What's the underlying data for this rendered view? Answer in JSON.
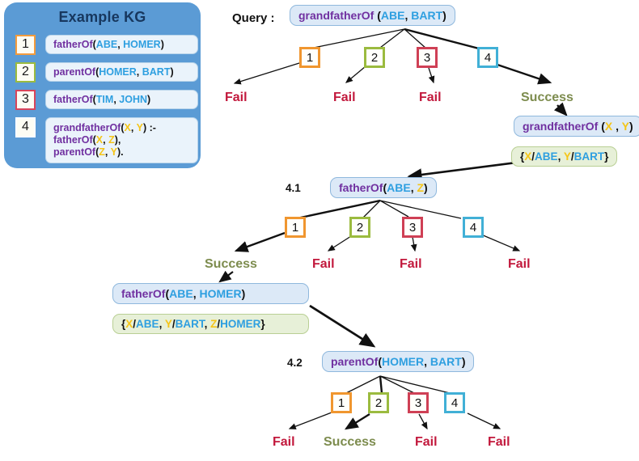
{
  "kg_panel": {
    "title": "Example KG",
    "rows": [
      {
        "badge": "1",
        "badge_color": "#f39c3d",
        "tokens": [
          {
            "t": "fatherOf",
            "c": "pred"
          },
          {
            "t": "(",
            "c": "punc"
          },
          {
            "t": "ABE",
            "c": "cons"
          },
          {
            "t": ", ",
            "c": "punc"
          },
          {
            "t": "HOMER",
            "c": "cons"
          },
          {
            "t": ")",
            "c": "punc"
          }
        ]
      },
      {
        "badge": "2",
        "badge_color": "#9bbb3f",
        "tokens": [
          {
            "t": "parentOf",
            "c": "pred"
          },
          {
            "t": "(",
            "c": "punc"
          },
          {
            "t": "HOMER",
            "c": "cons"
          },
          {
            "t": ", ",
            "c": "punc"
          },
          {
            "t": "BART",
            "c": "cons"
          },
          {
            "t": ")",
            "c": "punc"
          }
        ]
      },
      {
        "badge": "3",
        "badge_color": "#d9455b",
        "tokens": [
          {
            "t": "fatherOf",
            "c": "pred"
          },
          {
            "t": "(",
            "c": "punc"
          },
          {
            "t": "TIM",
            "c": "cons"
          },
          {
            "t": ", ",
            "c": "punc"
          },
          {
            "t": "JOHN",
            "c": "cons"
          },
          {
            "t": ")",
            "c": "punc"
          }
        ]
      },
      {
        "badge": "4",
        "badge_color": "#ffffff",
        "tokens": [
          {
            "t": "grandfatherOf",
            "c": "pred"
          },
          {
            "t": "(",
            "c": "punc"
          },
          {
            "t": "X",
            "c": "vr"
          },
          {
            "t": ", ",
            "c": "punc"
          },
          {
            "t": "Y",
            "c": "vr"
          },
          {
            "t": ") :-",
            "c": "punc"
          },
          {
            "t": "<br>",
            "c": "br"
          },
          {
            "t": "fatherOf",
            "c": "pred"
          },
          {
            "t": "(",
            "c": "punc"
          },
          {
            "t": "X",
            "c": "vr"
          },
          {
            "t": ", ",
            "c": "punc"
          },
          {
            "t": "Z",
            "c": "vr"
          },
          {
            "t": "),",
            "c": "punc"
          },
          {
            "t": "<br>",
            "c": "br"
          },
          {
            "t": "parentOf",
            "c": "pred"
          },
          {
            "t": "(",
            "c": "punc"
          },
          {
            "t": "Z",
            "c": "vr"
          },
          {
            "t": ", ",
            "c": "punc"
          },
          {
            "t": "Y",
            "c": "vr"
          },
          {
            "t": ").",
            "c": "punc"
          }
        ]
      }
    ]
  },
  "query": {
    "label": "Query :",
    "tokens": [
      {
        "t": "grandfatherOf",
        "c": "pred"
      },
      {
        "t": " (",
        "c": "punc"
      },
      {
        "t": "ABE",
        "c": "cons"
      },
      {
        "t": ", ",
        "c": "punc"
      },
      {
        "t": "BART",
        "c": "cons"
      },
      {
        "t": ")",
        "c": "punc"
      }
    ]
  },
  "level1": {
    "badges": [
      "1",
      "2",
      "3",
      "4"
    ],
    "badge_colors": [
      "#f0962f",
      "#9bbb3f",
      "#cf4055",
      "#41b0d6"
    ],
    "results": [
      "Fail",
      "Fail",
      "Fail",
      "Success"
    ],
    "result_kinds": [
      "fail",
      "fail",
      "fail",
      "succ"
    ]
  },
  "rule_head": {
    "tokens": [
      {
        "t": "grandfatherOf",
        "c": "pred"
      },
      {
        "t": " (",
        "c": "punc"
      },
      {
        "t": "X",
        "c": "vr"
      },
      {
        "t": " , ",
        "c": "punc"
      },
      {
        "t": "Y",
        "c": "vr"
      },
      {
        "t": ")",
        "c": "punc"
      }
    ]
  },
  "binding1": {
    "tokens": [
      {
        "t": "{",
        "c": "punc"
      },
      {
        "t": "X",
        "c": "vr"
      },
      {
        "t": "/",
        "c": "punc"
      },
      {
        "t": "ABE",
        "c": "cons"
      },
      {
        "t": ", ",
        "c": "punc"
      },
      {
        "t": "Y",
        "c": "vr"
      },
      {
        "t": "/",
        "c": "punc"
      },
      {
        "t": "BART",
        "c": "cons"
      },
      {
        "t": "}",
        "c": "punc"
      }
    ]
  },
  "step41": {
    "label": "4.1",
    "tokens": [
      {
        "t": "fatherOf",
        "c": "pred"
      },
      {
        "t": "(",
        "c": "punc"
      },
      {
        "t": "ABE",
        "c": "cons"
      },
      {
        "t": ", ",
        "c": "punc"
      },
      {
        "t": "Z",
        "c": "vr"
      },
      {
        "t": ")",
        "c": "punc"
      }
    ]
  },
  "level2": {
    "badges": [
      "1",
      "2",
      "3",
      "4"
    ],
    "badge_colors": [
      "#f0962f",
      "#9bbb3f",
      "#cf4055",
      "#41b0d6"
    ],
    "results": [
      "Success",
      "Fail",
      "Fail",
      "Fail"
    ],
    "result_kinds": [
      "succ",
      "fail",
      "fail",
      "fail"
    ]
  },
  "match1": {
    "tokens": [
      {
        "t": "fatherOf",
        "c": "pred"
      },
      {
        "t": "(",
        "c": "punc"
      },
      {
        "t": "ABE",
        "c": "cons"
      },
      {
        "t": ", ",
        "c": "punc"
      },
      {
        "t": "HOMER",
        "c": "cons"
      },
      {
        "t": ")",
        "c": "punc"
      }
    ]
  },
  "binding2": {
    "tokens": [
      {
        "t": "{",
        "c": "punc"
      },
      {
        "t": "X",
        "c": "vr"
      },
      {
        "t": "/",
        "c": "punc"
      },
      {
        "t": "ABE",
        "c": "cons"
      },
      {
        "t": ", ",
        "c": "punc"
      },
      {
        "t": "Y",
        "c": "vr"
      },
      {
        "t": "/",
        "c": "punc"
      },
      {
        "t": "BART",
        "c": "cons"
      },
      {
        "t": ", ",
        "c": "punc"
      },
      {
        "t": "Z",
        "c": "vr"
      },
      {
        "t": "/",
        "c": "punc"
      },
      {
        "t": "HOMER",
        "c": "cons"
      },
      {
        "t": "}",
        "c": "punc"
      }
    ]
  },
  "step42": {
    "label": "4.2",
    "tokens": [
      {
        "t": "parentOf",
        "c": "pred"
      },
      {
        "t": "(",
        "c": "punc"
      },
      {
        "t": "HOMER",
        "c": "cons"
      },
      {
        "t": ", ",
        "c": "punc"
      },
      {
        "t": "BART",
        "c": "cons"
      },
      {
        "t": ")",
        "c": "punc"
      }
    ]
  },
  "level3": {
    "badges": [
      "1",
      "2",
      "3",
      "4"
    ],
    "badge_colors": [
      "#f0962f",
      "#9bbb3f",
      "#cf4055",
      "#41b0d6"
    ],
    "results": [
      "Fail",
      "Success",
      "Fail",
      "Fail"
    ],
    "result_kinds": [
      "fail",
      "succ",
      "fail",
      "fail"
    ]
  },
  "colors": {
    "panel_bg": "#5b9bd5",
    "node_bg": "#dce9f7",
    "node_border": "#8fb8dd",
    "sub_bg": "#e7f0d8",
    "sub_border": "#b9cf94",
    "predicate": "#7030a0",
    "constant": "#2e9fe0",
    "variable": "#f5c518",
    "fail": "#c2183c",
    "success": "#7d8c4e"
  }
}
